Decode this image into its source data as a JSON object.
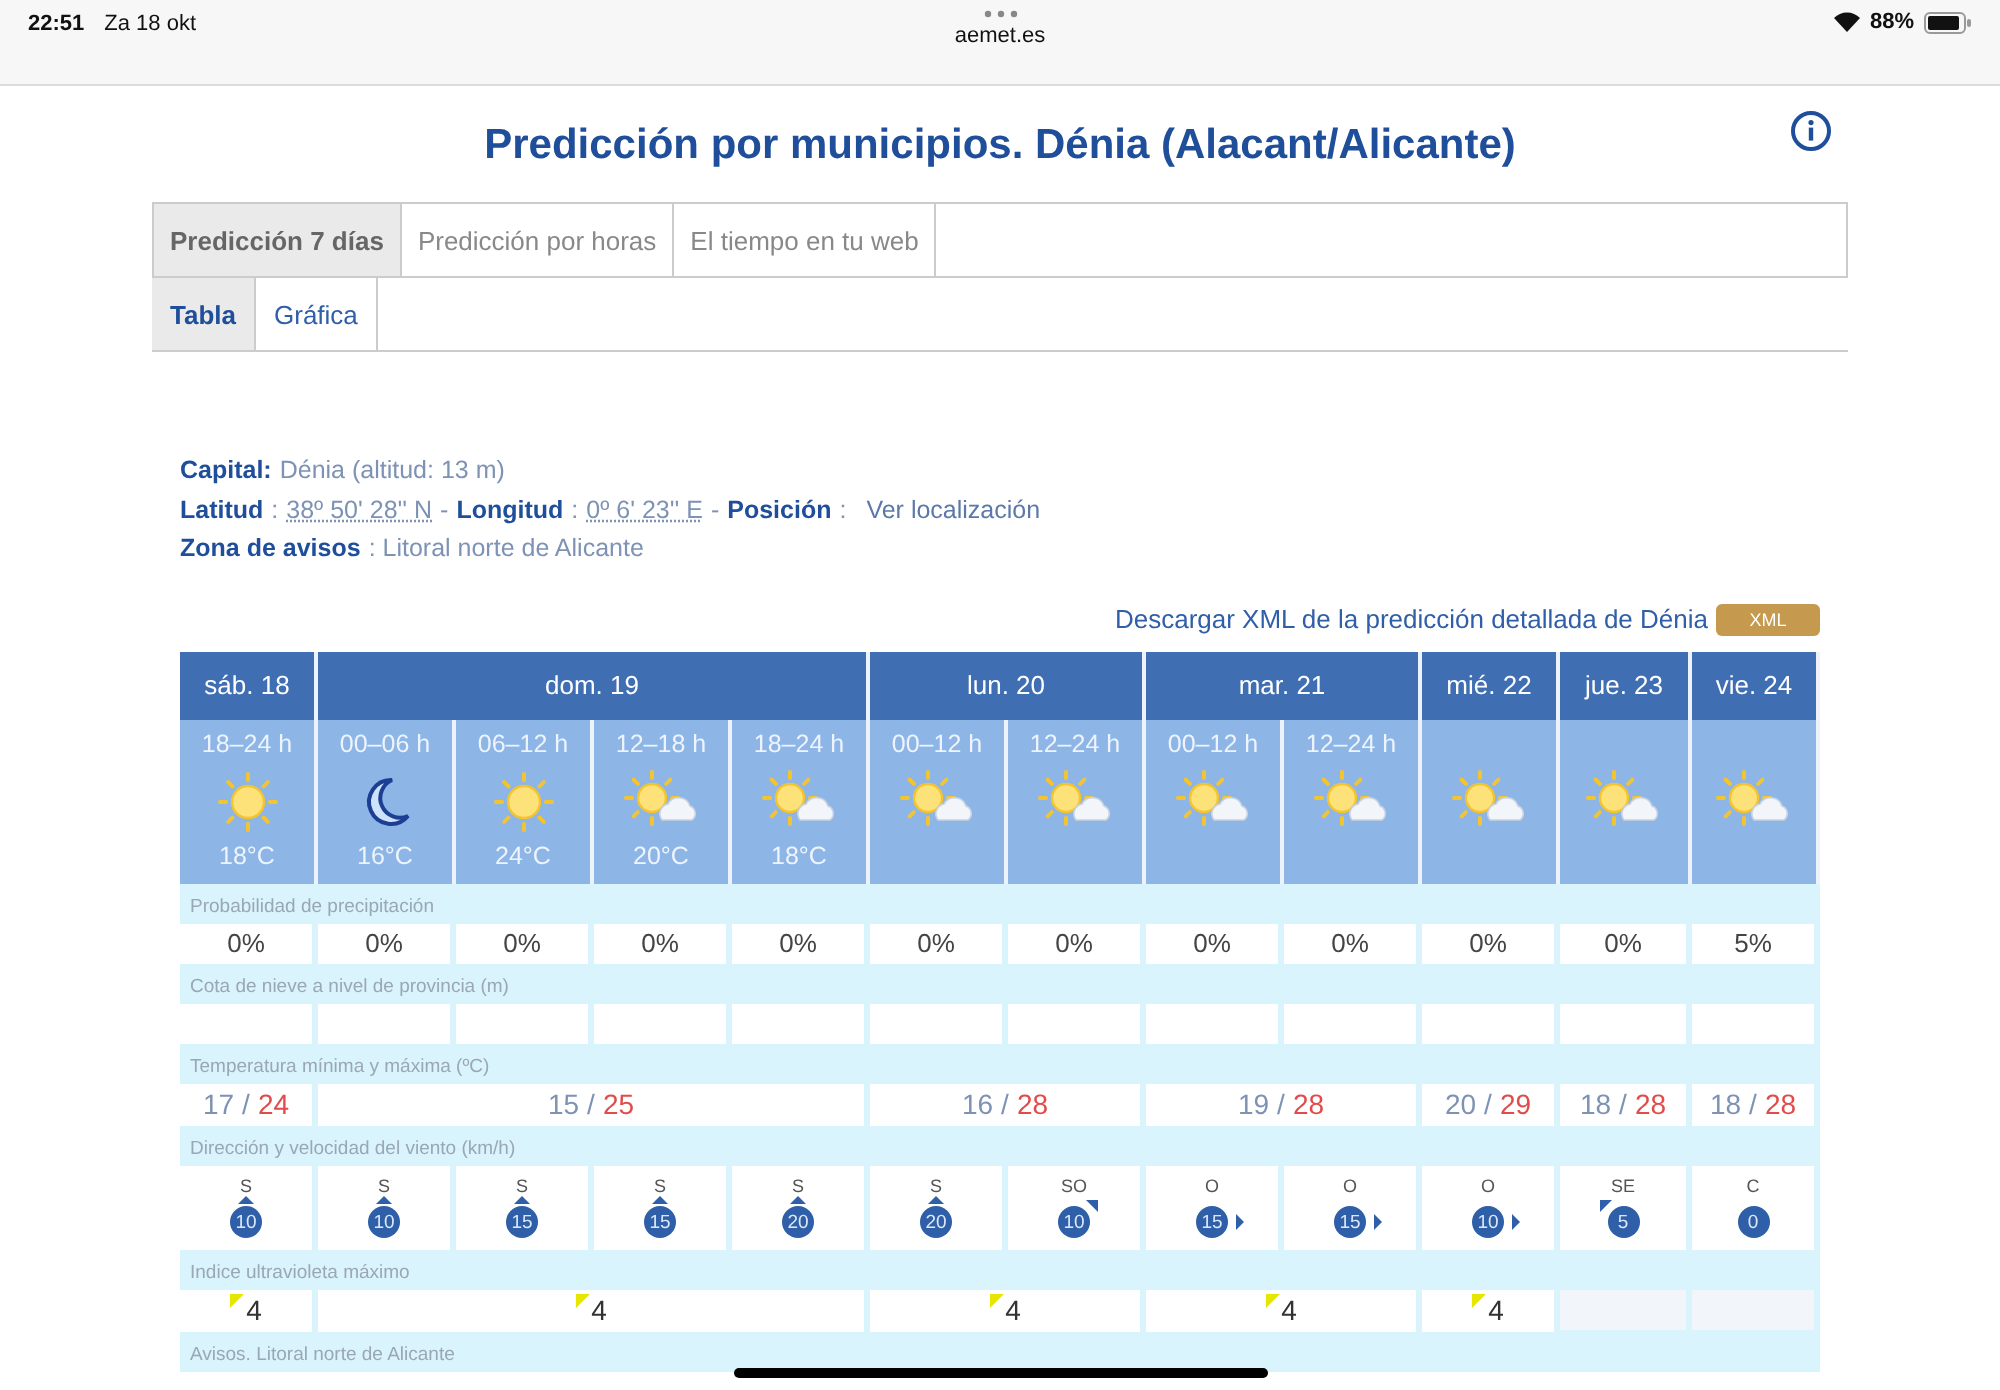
{
  "status_bar": {
    "time": "22:51",
    "date": "Za 18 okt",
    "url": "aemet.es",
    "battery": "88%"
  },
  "title": "Predicción por municipios. Dénia (Alacant/Alicante)",
  "tabs": [
    {
      "label": "Predicción 7 días",
      "selected": true
    },
    {
      "label": "Predicción por horas",
      "selected": false
    },
    {
      "label": "El tiempo en tu web",
      "selected": false
    }
  ],
  "subtabs": [
    {
      "label": "Tabla",
      "selected": true
    },
    {
      "label": "Gráfica",
      "selected": false
    }
  ],
  "info": [
    {
      "parts": [
        {
          "kind": "label",
          "text": "Capital:"
        },
        {
          "kind": "value",
          "text": "Dénia (altitud: 13 m)"
        }
      ]
    },
    {
      "parts": [
        {
          "kind": "label",
          "text": "Latitud"
        },
        {
          "kind": "value",
          "text": ":"
        },
        {
          "kind": "abbr",
          "text": "38º 50' 28'' N"
        },
        {
          "kind": "value",
          "text": "-"
        },
        {
          "kind": "label",
          "text": "Longitud"
        },
        {
          "kind": "value",
          "text": ":"
        },
        {
          "kind": "abbr",
          "text": "0º 6' 23'' E"
        },
        {
          "kind": "value",
          "text": "-"
        },
        {
          "kind": "label",
          "text": "Posición"
        },
        {
          "kind": "value",
          "text": ":"
        },
        {
          "kind": "link",
          "text": "Ver localización"
        }
      ]
    },
    {
      "parts": [
        {
          "kind": "label",
          "text": "Zona de avisos"
        },
        {
          "kind": "value",
          "text": ": Litoral norte de Alicante"
        }
      ]
    }
  ],
  "download": {
    "text": "Descargar XML de la predicción detallada de Dénia",
    "button": "XML"
  },
  "row_labels": {
    "precipitation": "Probabilidad de precipitación",
    "snow": "Cota de nieve a nivel de provincia (m)",
    "temperature": "Temperatura mínima y máxima (ºC)",
    "wind": "Dirección y velocidad del viento (km/h)",
    "uv": "Indice ultravioleta máximo",
    "warnings": "Avisos. Litoral norte de Alicante"
  },
  "days": [
    {
      "label": "sáb. 18",
      "temp": {
        "min": "17",
        "separator": "/",
        "max": "24"
      },
      "uv": "4",
      "periods": [
        {
          "time": "18–24 h",
          "kind": "sun",
          "temp": "18°C",
          "precipitation": "0%",
          "wind": {
            "direction": "S",
            "speed": "10",
            "kind": "north"
          }
        }
      ]
    },
    {
      "label": "dom. 19",
      "temp": {
        "min": "15",
        "separator": "/",
        "max": "25"
      },
      "uv": "4",
      "periods": [
        {
          "time": "00–06 h",
          "kind": "moon",
          "temp": "16°C",
          "precipitation": "0%",
          "wind": {
            "direction": "S",
            "speed": "10",
            "kind": "north"
          }
        },
        {
          "time": "06–12 h",
          "kind": "sun",
          "temp": "24°C",
          "precipitation": "0%",
          "wind": {
            "direction": "S",
            "speed": "15",
            "kind": "north"
          }
        },
        {
          "time": "12–18 h",
          "kind": "partly",
          "temp": "20°C",
          "precipitation": "0%",
          "wind": {
            "direction": "S",
            "speed": "15",
            "kind": "north"
          }
        },
        {
          "time": "18–24 h",
          "kind": "partly",
          "temp": "18°C",
          "precipitation": "0%",
          "wind": {
            "direction": "S",
            "speed": "20",
            "kind": "north"
          }
        }
      ]
    },
    {
      "label": "lun. 20",
      "temp": {
        "min": "16",
        "separator": "/",
        "max": "28"
      },
      "uv": "4",
      "periods": [
        {
          "time": "00–12 h",
          "kind": "partly",
          "precipitation": "0%",
          "wind": {
            "direction": "S",
            "speed": "20",
            "kind": "north"
          }
        },
        {
          "time": "12–24 h",
          "kind": "partly",
          "precipitation": "0%",
          "wind": {
            "direction": "SO",
            "speed": "10",
            "kind": "northeast"
          }
        }
      ]
    },
    {
      "label": "mar. 21",
      "temp": {
        "min": "19",
        "separator": "/",
        "max": "28"
      },
      "uv": "4",
      "periods": [
        {
          "time": "00–12 h",
          "kind": "partly",
          "precipitation": "0%",
          "wind": {
            "direction": "O",
            "speed": "15",
            "kind": "east"
          }
        },
        {
          "time": "12–24 h",
          "kind": "partly",
          "precipitation": "0%",
          "wind": {
            "direction": "O",
            "speed": "15",
            "kind": "east"
          }
        }
      ]
    },
    {
      "label": "mié. 22",
      "temp": {
        "min": "20",
        "separator": "/",
        "max": "29"
      },
      "uv": "4",
      "periods": [
        {
          "kind": "partly",
          "precipitation": "0%",
          "wind": {
            "direction": "O",
            "speed": "10",
            "kind": "east"
          }
        }
      ]
    },
    {
      "label": "jue. 23",
      "temp": {
        "min": "18",
        "separator": "/",
        "max": "28"
      },
      "periods": [
        {
          "kind": "partly",
          "precipitation": "0%",
          "wind": {
            "direction": "SE",
            "speed": "5",
            "kind": "northwest"
          }
        }
      ]
    },
    {
      "label": "vie. 24",
      "temp": {
        "min": "18",
        "separator": "/",
        "max": "28"
      },
      "periods": [
        {
          "kind": "partly",
          "precipitation": "5%",
          "wind": {
            "direction": "C",
            "speed": "0",
            "kind": "calm"
          }
        }
      ]
    }
  ]
}
